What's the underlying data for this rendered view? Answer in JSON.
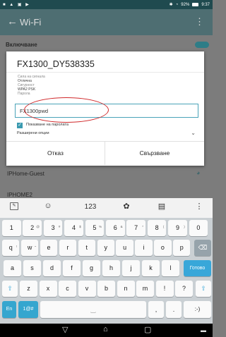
{
  "status": {
    "left_icons": "■ ▲ ▣ ▶",
    "battery": "92%",
    "time": "9:37"
  },
  "appbar": {
    "title": "Wi-Fi",
    "back": "←",
    "menu": "⋮"
  },
  "settings": {
    "enable_label": "Включване"
  },
  "dialog": {
    "title": "FX1300_DY538335",
    "signal_label": "Сила на сигнала",
    "signal_value": "Отлична",
    "security_label": "Сигурност",
    "security_value": "WPA2 PSK",
    "password_label": "Парола",
    "password_value": "FX1300pwd",
    "show_password_label": "Показване на паролата",
    "advanced_label": "Разширени опции",
    "cancel_label": "Отказ",
    "connect_label": "Свързване"
  },
  "networks": [
    {
      "name": "IPHome-Guest"
    },
    {
      "name": "IPHOME2"
    }
  ],
  "keyboard": {
    "toolbar": {
      "num_label": "123"
    },
    "row1": [
      {
        "k": "1",
        "s": ""
      },
      {
        "k": "2",
        "s": "@"
      },
      {
        "k": "3",
        "s": "#"
      },
      {
        "k": "4",
        "s": "$"
      },
      {
        "k": "5",
        "s": "%"
      },
      {
        "k": "6",
        "s": "&"
      },
      {
        "k": "7",
        "s": "*"
      },
      {
        "k": "8",
        "s": "("
      },
      {
        "k": "9",
        "s": ")"
      },
      {
        "k": "0",
        "s": ""
      }
    ],
    "row2": [
      {
        "k": "q",
        "s": "!"
      },
      {
        "k": "w",
        "s": "~"
      },
      {
        "k": "e",
        "s": ""
      },
      {
        "k": "r",
        "s": ""
      },
      {
        "k": "t",
        "s": ""
      },
      {
        "k": "y",
        "s": ""
      },
      {
        "k": "u",
        "s": ""
      },
      {
        "k": "i",
        "s": ""
      },
      {
        "k": "o",
        "s": ""
      },
      {
        "k": "p",
        "s": ""
      }
    ],
    "row3": [
      "a",
      "s",
      "d",
      "f",
      "g",
      "h",
      "j",
      "k",
      "l"
    ],
    "row4": [
      "z",
      "x",
      "c",
      "v",
      "b",
      "n",
      "m",
      "!",
      "?"
    ],
    "done_label": "Готово",
    "lang_label": "En",
    "sym_label": "1@#",
    "comma_label": ",",
    "period_label": ".",
    "emoticon_label": ":-)"
  }
}
